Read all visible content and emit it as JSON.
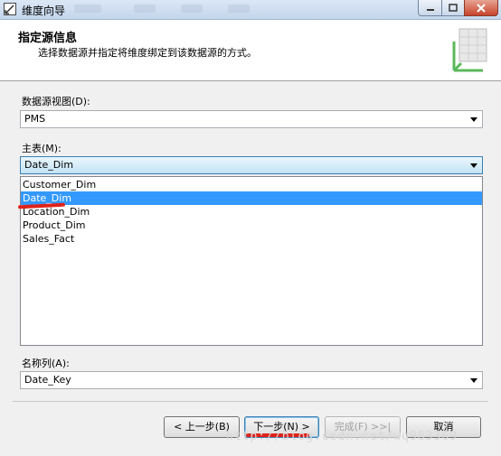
{
  "window": {
    "title": "维度向导",
    "controls": {
      "minimize": "minimize-icon",
      "maximize": "maximize-icon",
      "close": "close-icon"
    }
  },
  "header": {
    "title": "指定源信息",
    "subtitle": "选择数据源并指定将维度绑定到该数据源的方式。",
    "graphic": "dimension-cube-icon"
  },
  "form": {
    "dsv_label": "数据源视图(D):",
    "dsv_value": "PMS",
    "main_table_label": "主表(M):",
    "main_table_value": "Date_Dim",
    "table_options": [
      "Customer_Dim",
      "Date_Dim",
      "Location_Dim",
      "Product_Dim",
      "Sales_Fact"
    ],
    "selected_option": "Date_Dim",
    "name_column_label": "名称列(A):",
    "name_column_value": "Date_Key"
  },
  "buttons": {
    "back": "< 上一步(B)",
    "next": "下一步(N) >",
    "finish": "完成(F) >>|",
    "cancel": "取消"
  },
  "watermark": "http://blog.csdn.net/wq983369",
  "colors": {
    "selection": "#3399ff",
    "annotation": "#e0231a"
  }
}
